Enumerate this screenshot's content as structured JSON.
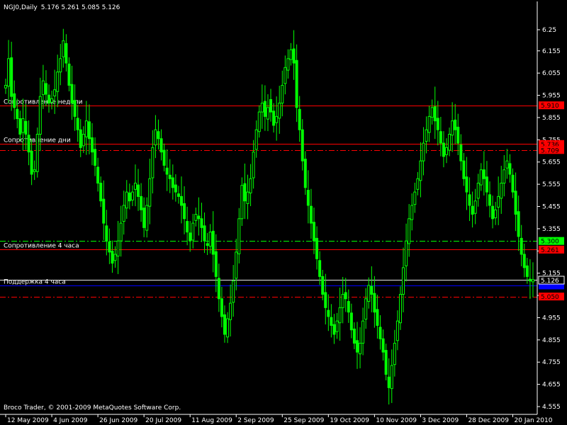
{
  "header": {
    "symbol": "NGJ0,Daily",
    "ohlc": "5.176 5.261 5.085 5.126"
  },
  "footer": {
    "copyright": "Broco Trader, © 2001-2009 MetaQuotes Software Corp."
  },
  "colors": {
    "background": "#000000",
    "candle": "#00ff00",
    "resistance": "#ff0000",
    "support": "#0000ff",
    "level_green": "#00ff00",
    "current_price": "#ffffff"
  },
  "chart_data": {
    "type": "candlestick",
    "title": "",
    "ylim": [
      4.52,
      6.32
    ],
    "y_ticks": [
      6.25,
      6.155,
      6.055,
      5.955,
      5.855,
      5.755,
      5.655,
      5.555,
      5.455,
      5.355,
      5.255,
      5.155,
      5.055,
      4.955,
      4.855,
      4.755,
      4.655,
      4.555
    ],
    "x_ticks": [
      "12 May 2009",
      "4 Jun 2009",
      "26 Jun 2009",
      "20 Jul 2009",
      "11 Aug 2009",
      "2 Sep 2009",
      "25 Sep 2009",
      "19 Oct 2009",
      "10 Nov 2009",
      "3 Dec 2009",
      "28 Dec 2009",
      "20 Jan 2010"
    ],
    "x_tick_index": [
      0,
      16,
      32,
      48,
      64,
      80,
      96,
      112,
      128,
      144,
      160,
      176
    ],
    "bar_count": 184,
    "closes": [
      6.0,
      6.12,
      5.95,
      5.9,
      5.85,
      5.78,
      5.85,
      5.78,
      5.7,
      5.6,
      5.62,
      5.78,
      5.95,
      6.02,
      5.96,
      5.92,
      5.94,
      5.98,
      6.06,
      6.12,
      6.2,
      6.1,
      6.0,
      5.92,
      5.86,
      5.8,
      5.72,
      5.78,
      5.84,
      5.76,
      5.7,
      5.64,
      5.56,
      5.48,
      5.38,
      5.3,
      5.25,
      5.2,
      5.24,
      5.3,
      5.38,
      5.46,
      5.52,
      5.48,
      5.52,
      5.56,
      5.5,
      5.44,
      5.36,
      5.46,
      5.58,
      5.72,
      5.8,
      5.76,
      5.7,
      5.64,
      5.6,
      5.58,
      5.54,
      5.52,
      5.5,
      5.46,
      5.4,
      5.34,
      5.3,
      5.38,
      5.42,
      5.4,
      5.36,
      5.3,
      5.28,
      5.34,
      5.24,
      5.14,
      5.04,
      4.96,
      4.88,
      4.95,
      5.02,
      5.12,
      5.25,
      5.4,
      5.55,
      5.48,
      5.52,
      5.58,
      5.7,
      5.8,
      5.88,
      5.92,
      5.86,
      5.9,
      5.94,
      5.88,
      5.82,
      5.86,
      5.92,
      6.0,
      6.08,
      6.12,
      6.16,
      6.1,
      5.9,
      5.8,
      5.66,
      5.54,
      5.46,
      5.38,
      5.3,
      5.22,
      5.14,
      5.06,
      5.0,
      4.96,
      4.92,
      4.88,
      4.94,
      5.0,
      5.06,
      5.04,
      4.98,
      4.9,
      4.84,
      4.8,
      4.84,
      4.94,
      5.04,
      5.1,
      5.06,
      4.98,
      4.92,
      4.86,
      4.8,
      4.7,
      4.64,
      4.74,
      4.84,
      4.94,
      5.06,
      5.18,
      5.3,
      5.4,
      5.46,
      5.52,
      5.58,
      5.66,
      5.74,
      5.8,
      5.86,
      5.9,
      5.84,
      5.8,
      5.74,
      5.68,
      5.72,
      5.78,
      5.84,
      5.8,
      5.74,
      5.66,
      5.58,
      5.52,
      5.46,
      5.42,
      5.48,
      5.56,
      5.62,
      5.58,
      5.52,
      5.46,
      5.4,
      5.44,
      5.5,
      5.56,
      5.62,
      5.66,
      5.6,
      5.52,
      5.42,
      5.32,
      5.24,
      5.18,
      5.14,
      5.12,
      5.126,
      5.13
    ],
    "levels": [
      {
        "label": "Сопротивление недели",
        "price": 5.91,
        "price_text": "5.910",
        "style": "solid",
        "color": "#ff0000",
        "tag_bg": "#ff0000",
        "tag_fg": "#000000"
      },
      {
        "label": "Сопротивление дни",
        "price": 5.736,
        "price_text": "5.736",
        "style": "solid",
        "color": "#ff0000",
        "tag_bg": "#ff0000",
        "tag_fg": "#000000"
      },
      {
        "label": "",
        "price": 5.709,
        "price_text": "5.709",
        "style": "dashdot",
        "color": "#ff0000",
        "tag_bg": "#ff0000",
        "tag_fg": "#000000"
      },
      {
        "label": "",
        "price": 5.3,
        "price_text": "5.300",
        "style": "dashdot",
        "color": "#00ff00",
        "tag_bg": "#00ff00",
        "tag_fg": "#000000"
      },
      {
        "label": "Сопротивление 4 часа",
        "price": 5.261,
        "price_text": "5.261",
        "style": "solid",
        "color": "#ff0000",
        "tag_bg": "#ff0000",
        "tag_fg": "#000000"
      },
      {
        "label": "Поддержка 4 часа",
        "price": 5.1,
        "price_text": "5.100",
        "style": "solid",
        "color": "#0000ff",
        "tag_bg": "#0000ff",
        "tag_fg": "#0000ff"
      },
      {
        "label": "",
        "price": 5.05,
        "price_text": "5.050",
        "style": "dashdot",
        "color": "#ff0000",
        "tag_bg": "#ff0000",
        "tag_fg": "#000000"
      }
    ],
    "current_price": {
      "price": 5.126,
      "price_text": "5.126"
    }
  }
}
